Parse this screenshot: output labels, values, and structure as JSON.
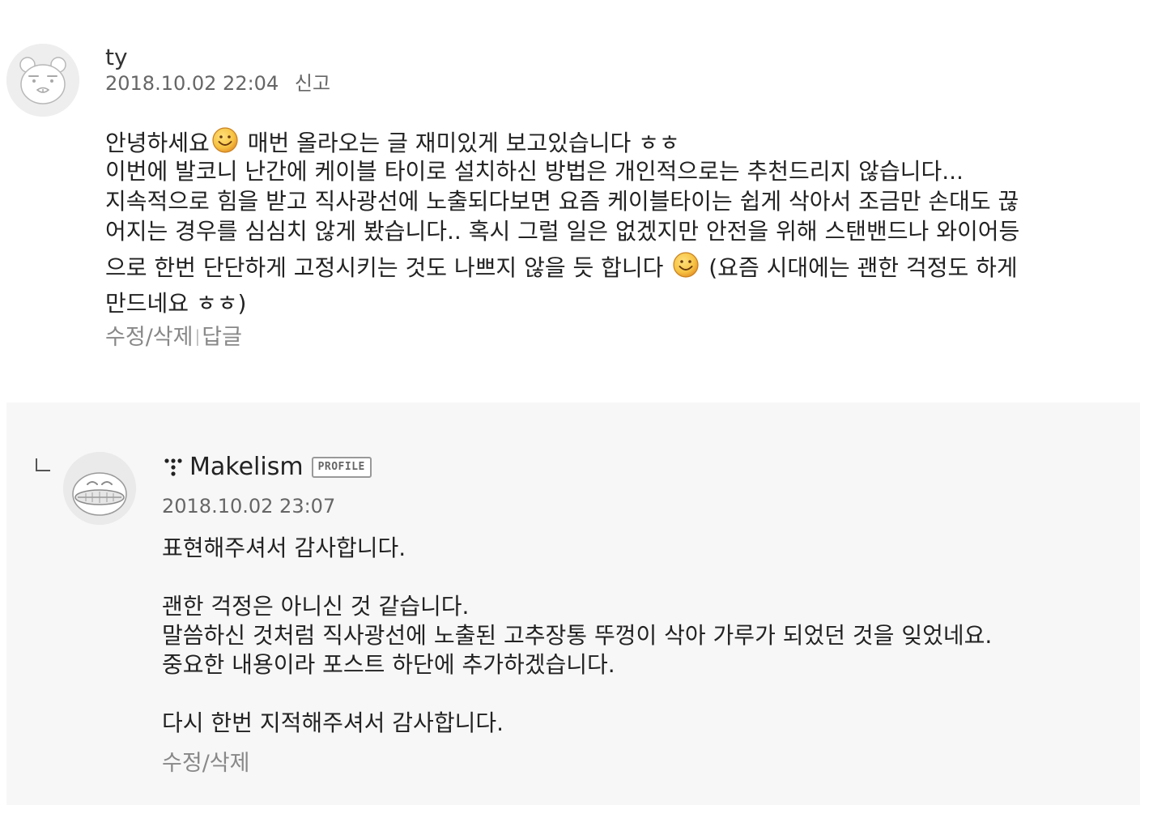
{
  "comment": {
    "author": "ty",
    "datetime": "2018.10.02 22:04",
    "report_label": "신고",
    "avatar_icon": "bear-face-avatar-icon",
    "lines": {
      "l1a": "안녕하세요",
      "l1b": " 매번 올라오는 글 재미있게 보고있습니다 ㅎㅎ",
      "l2": "이번에 발코니 난간에 케이블 타이로 설치하신 방법은 개인적으로는 추천드리지 않습니다...",
      "l3": "지속적으로 힘을 받고 직사광선에 노출되다보면 요즘 케이블타이는 쉽게 삭아서 조금만 손대도 끊",
      "l4": "어지는 경우를 심심치 않게 봤습니다.. 혹시 그럴 일은 없겠지만 안전을 위해 스탠밴드나 와이어등",
      "l5a": "으로 한번 단단하게 고정시키는 것도 나쁘지 않을 듯 합니다 ",
      "l5b": " (요즘 시대에는 괜한 걱정도 하게",
      "l6": "만드네요 ㅎㅎ)"
    },
    "actions": {
      "edit": "수정",
      "slash": "/",
      "delete": "삭제",
      "divider": "|",
      "reply": "답글"
    },
    "smile_icon": "smile-emoticon-icon"
  },
  "reply": {
    "author": "Makelism",
    "profile_badge": "PROFILE",
    "datetime": "2018.10.02 23:07",
    "avatar_icon": "bird-face-avatar-icon",
    "lines": {
      "l1": "표현해주셔서 감사합니다.",
      "l2": "괜한 걱정은 아니신 것 같습니다.",
      "l3": "말씀하신 것처럼 직사광선에 노출된 고추장통 뚜껑이 삭아 가루가 되었던 것을 잊었네요.",
      "l4": "중요한 내용이라 포스트 하단에 추가하겠습니다.",
      "l5": "다시 한번 지적해주셔서 감사합니다."
    },
    "actions": {
      "edit": "수정",
      "slash": "/",
      "delete": "삭제"
    }
  },
  "colors": {
    "reply_background": "#f7f7f7",
    "avatar_background": "#eeeeee",
    "muted_text": "#888888",
    "smile_yellow": "#f6c343",
    "smile_orange": "#e89a2c"
  }
}
